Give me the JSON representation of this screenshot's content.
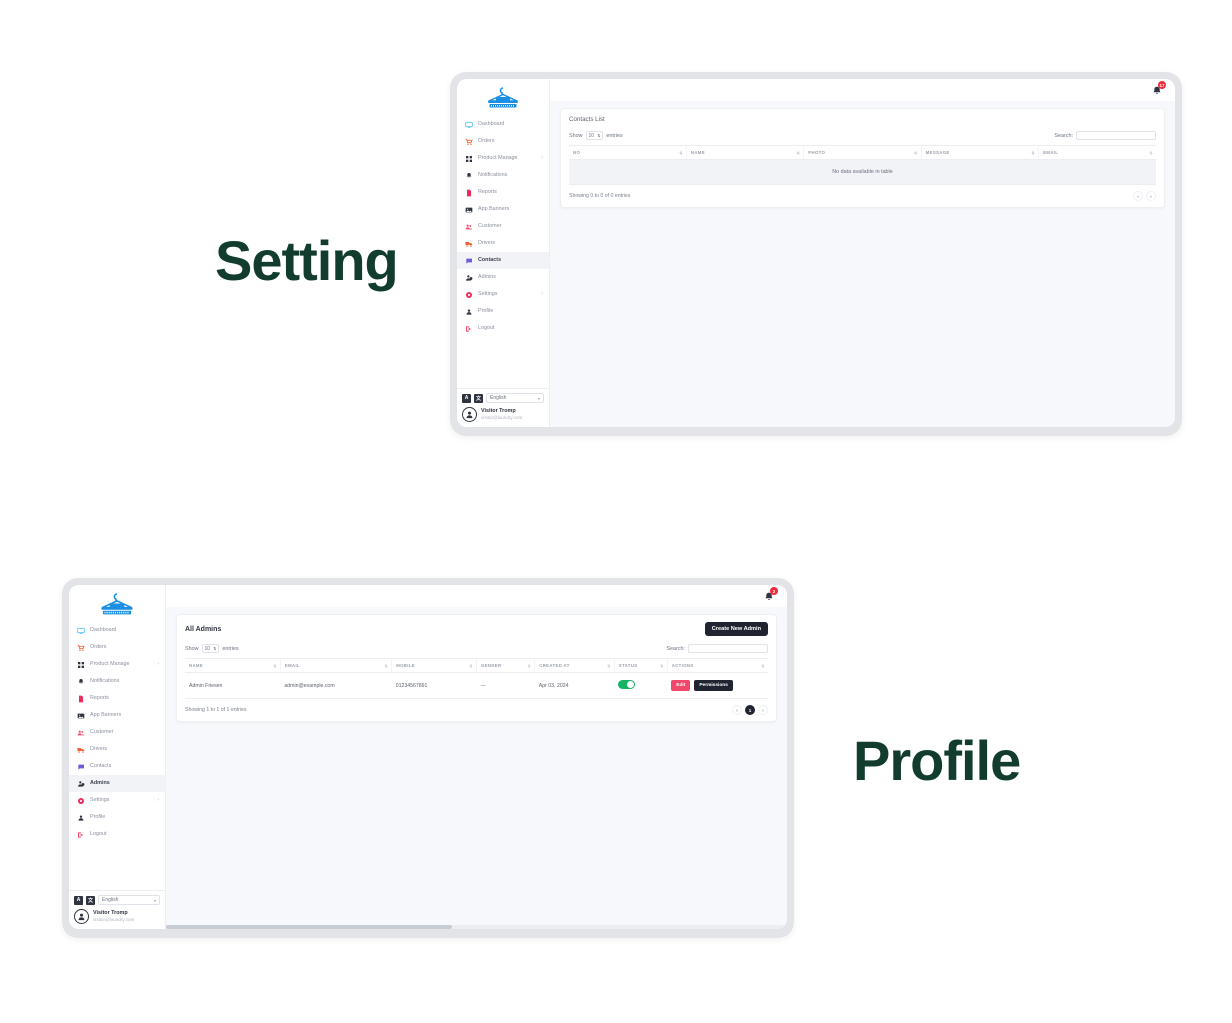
{
  "labels": {
    "setting": "Setting",
    "profile": "Profile",
    "accent_green": "#123d2e"
  },
  "brand": {
    "logo_text": "LAUNDRY BOSS",
    "logo_icon": "hanger-icon",
    "logo_color": "#1a8fe3"
  },
  "sidebar": {
    "items": [
      {
        "label": "Dashboard",
        "icon": "monitor-icon",
        "color": "#4fc3f7",
        "caret": ""
      },
      {
        "label": "Orders",
        "icon": "cart-icon",
        "color": "#f4623a",
        "caret": ""
      },
      {
        "label": "Product Manage",
        "icon": "grid-icon",
        "color": "#2f3440",
        "caret": "›"
      },
      {
        "label": "Notifications",
        "icon": "bell-icon",
        "color": "#2f3440",
        "caret": ""
      },
      {
        "label": "Reports",
        "icon": "file-icon",
        "color": "#ef2a5a",
        "caret": ""
      },
      {
        "label": "App Banners",
        "icon": "image-icon",
        "color": "#2f3440",
        "caret": ""
      },
      {
        "label": "Customer",
        "icon": "users-icon",
        "color": "#f0476a",
        "caret": ""
      },
      {
        "label": "Drivers",
        "icon": "truck-icon",
        "color": "#f4623a",
        "caret": ""
      },
      {
        "label": "Contacts",
        "icon": "chat-icon",
        "color": "#6f5bd8",
        "caret": ""
      },
      {
        "label": "Admins",
        "icon": "user-shield-icon",
        "color": "#2f3440",
        "caret": ""
      },
      {
        "label": "Settings",
        "icon": "gear-icon",
        "color": "#ef2a5a",
        "caret": "›"
      },
      {
        "label": "Profile",
        "icon": "person-icon",
        "color": "#2f3440",
        "caret": ""
      },
      {
        "label": "Logout",
        "icon": "logout-icon",
        "color": "#f0476a",
        "caret": ""
      }
    ],
    "language": {
      "btn_a": "A",
      "btn_b": "文",
      "selected": "English",
      "caret": "▾"
    },
    "user": {
      "name": "Visitor Tromp",
      "email": "visitor@laundry.com",
      "avatar": "user-avatar"
    }
  },
  "panel_setting": {
    "active_nav": "Contacts",
    "bell": {
      "icon": "bell-icon",
      "badge": "17"
    },
    "card_title": "Contacts List",
    "table_controls": {
      "show_label": "Show",
      "entries_label": "entries",
      "page_size": "10",
      "page_size_arrow": "⇅",
      "search_label": "Search:",
      "search_value": "",
      "search_placeholder": ""
    },
    "columns": [
      "NO",
      "NAME",
      "PHOTO",
      "MESSAGE",
      "EMAIL"
    ],
    "empty_message": "No data available in table",
    "footer_info": "Showing 0 to 0 of 0 entries",
    "pager": {
      "prev": "«",
      "next": "»"
    }
  },
  "panel_profile": {
    "active_nav": "Admins",
    "bell": {
      "icon": "bell-icon",
      "badge": "2"
    },
    "card_title": "All Admins",
    "create_button": "Create New Admin",
    "table_controls": {
      "show_label": "Show",
      "entries_label": "entries",
      "page_size": "10",
      "page_size_arrow": "⇅",
      "search_label": "Search:",
      "search_value": "",
      "search_placeholder": ""
    },
    "columns": [
      "NAME",
      "EMAIL",
      "MOBILE",
      "GENDER",
      "CREATED AT",
      "STATUS",
      "ACTIONS"
    ],
    "rows": [
      {
        "name": "Admin Friesen",
        "email": "admin@example.com",
        "mobile": "01234567891",
        "gender": "—",
        "created_at": "Apr 03, 2024",
        "status_on": true,
        "actions": {
          "edit": "Edit",
          "permissions": "Permissions"
        }
      }
    ],
    "footer_info": "Showing 1 to 1 of 1 entries",
    "pager": {
      "prev": "«",
      "current": "1",
      "next": "»"
    }
  }
}
